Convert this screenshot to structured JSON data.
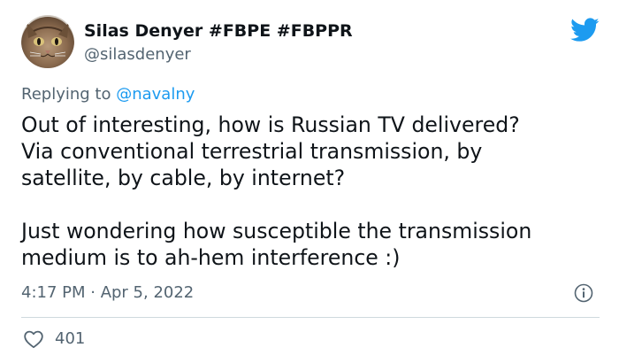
{
  "author": {
    "display_name": "Silas Denyer #FBPE #FBPPR",
    "handle": "@silasdenyer",
    "avatar": "cat-avatar"
  },
  "brand_icon": "twitter-bird-icon",
  "reply": {
    "prefix": "Replying to",
    "target": "@navalny"
  },
  "tweet": {
    "lines_para1": [
      "Out of interesting, how is Russian TV delivered?",
      "Via conventional terrestrial transmission, by",
      "satellite, by cable, by internet?"
    ],
    "lines_para2": [
      "Just wondering how susceptible the transmission",
      "medium is to ah-hem interference :)"
    ]
  },
  "meta": {
    "timestamp": "4:17 PM · Apr 5, 2022"
  },
  "engagement": {
    "likes": "401"
  },
  "colors": {
    "text": "#0f1419",
    "muted": "#536471",
    "link": "#1d9bf0",
    "divider": "#cfd9de"
  }
}
